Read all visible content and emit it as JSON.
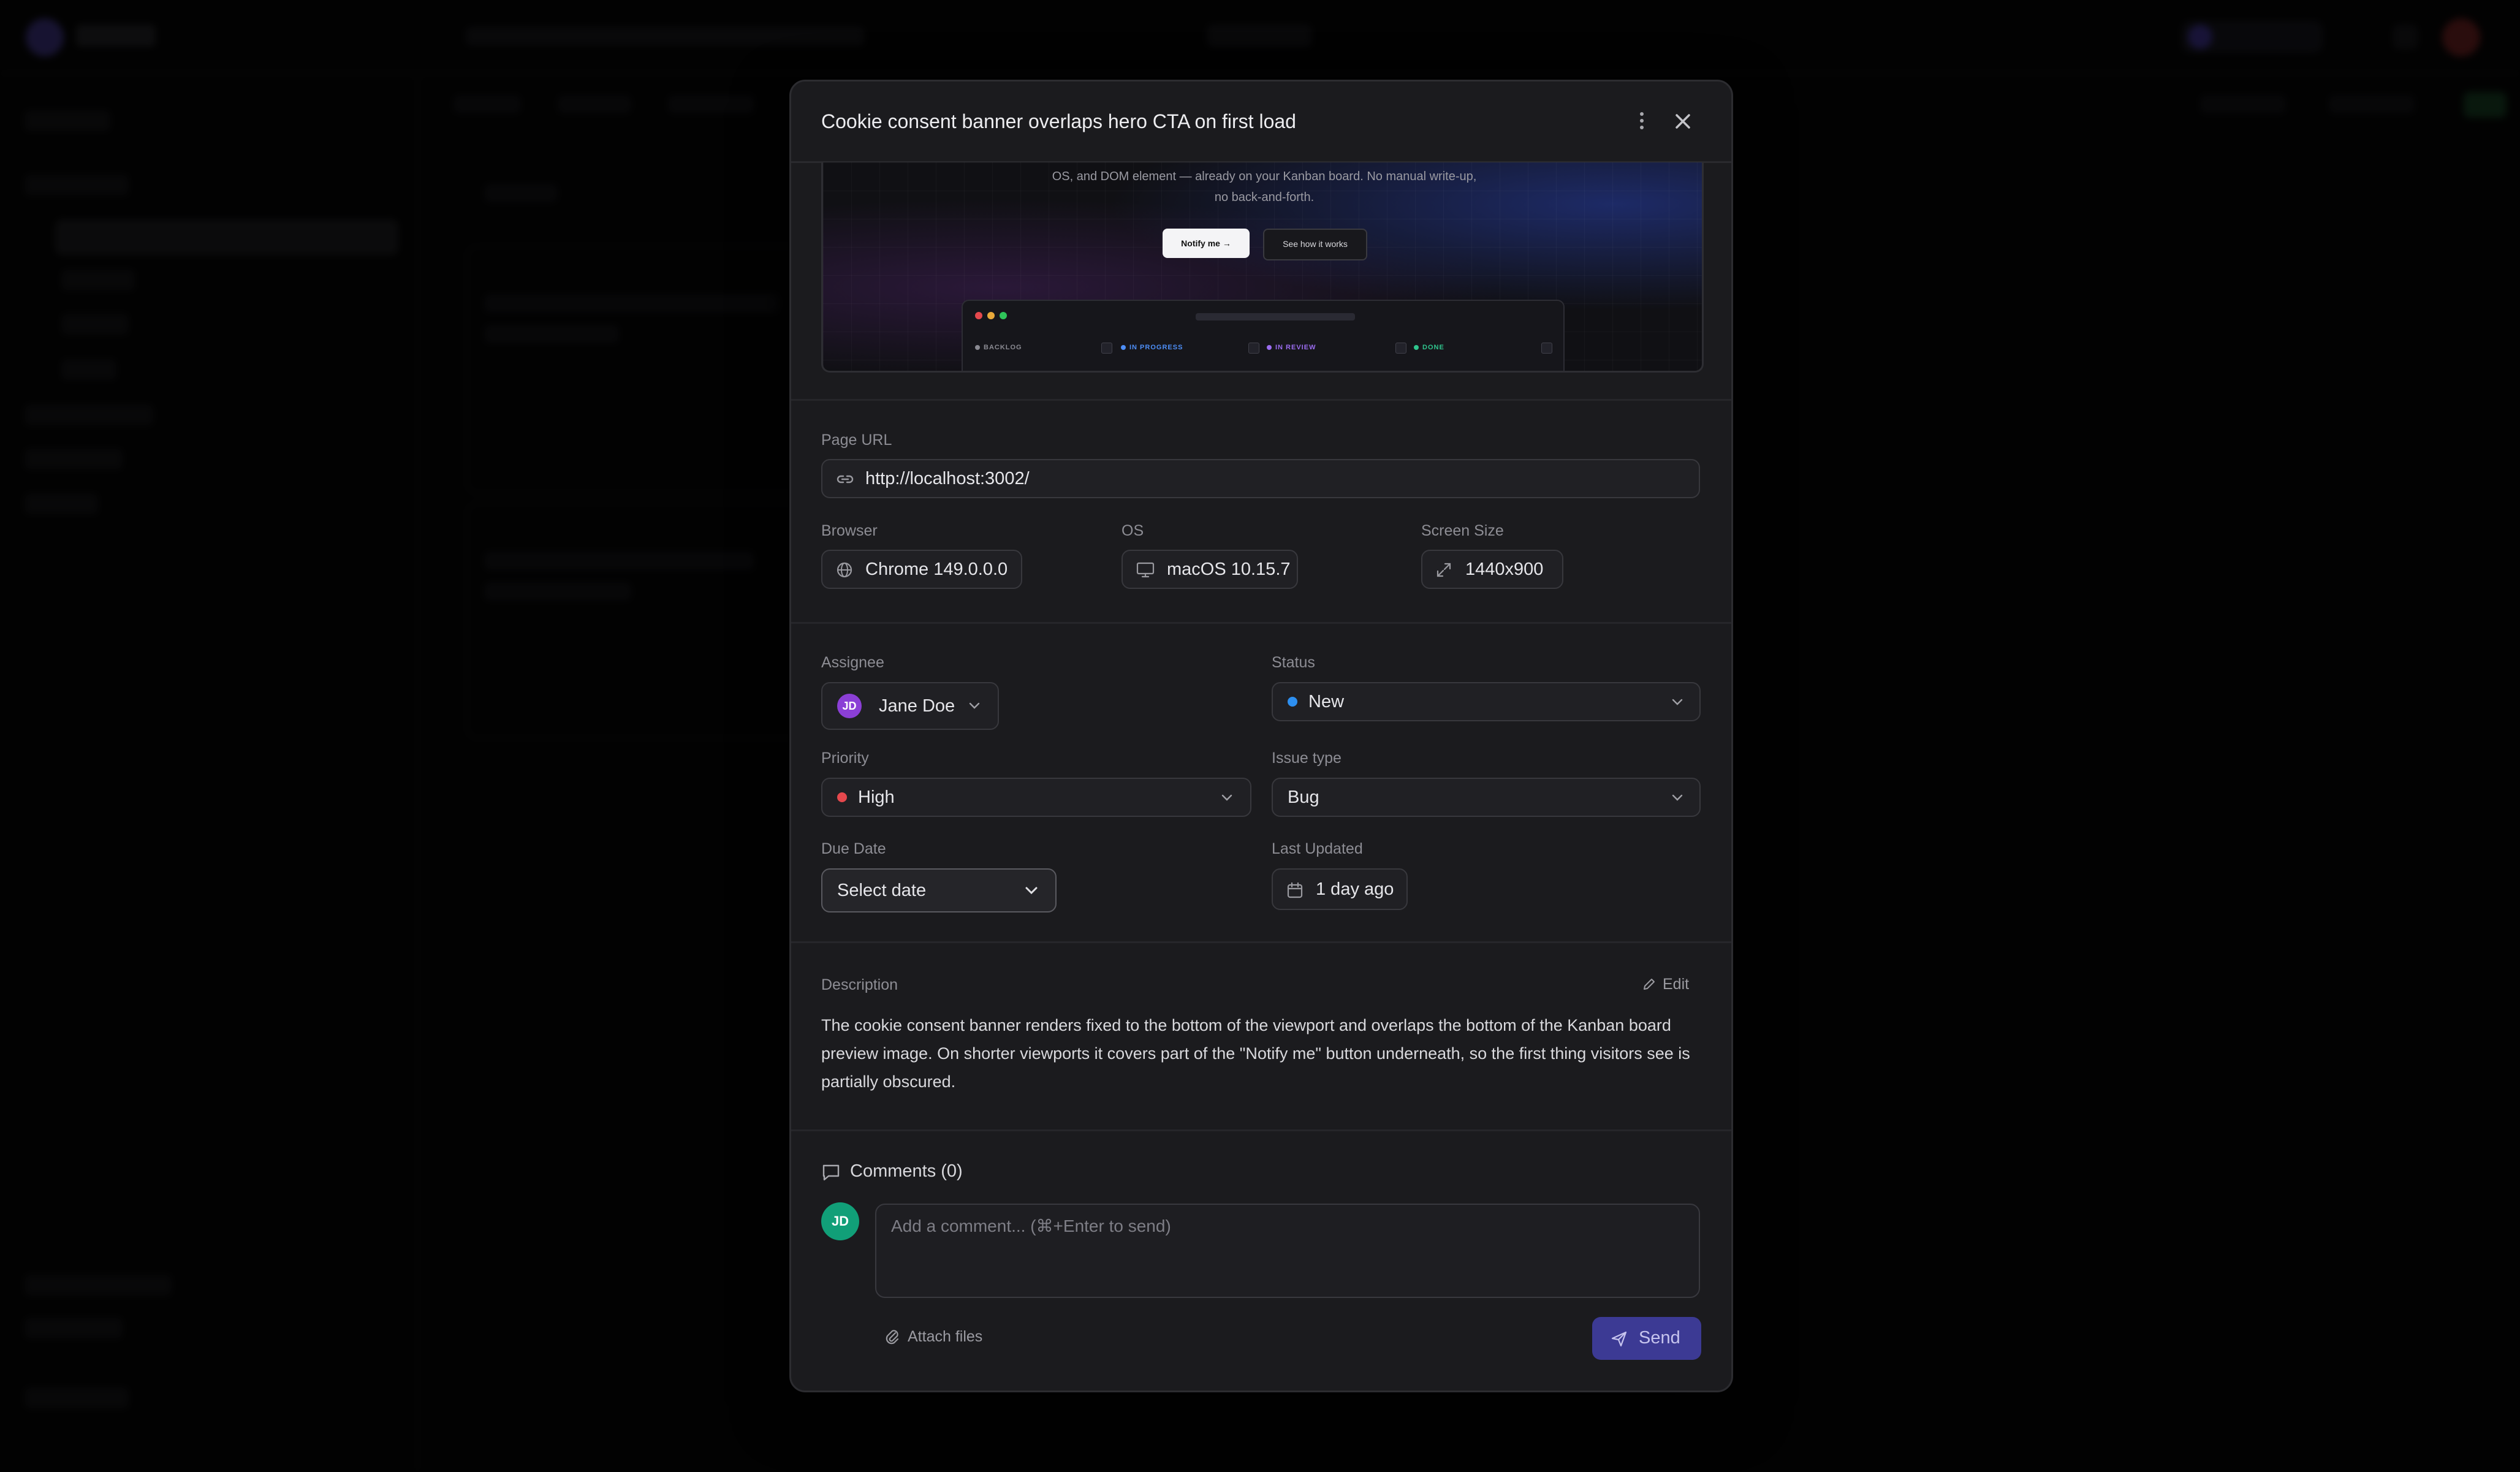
{
  "modal": {
    "title": "Cookie consent banner overlaps hero CTA on first load"
  },
  "screenshot_preview": {
    "text": "OS, and DOM element — already on your Kanban board. No manual write-up, no back-and-forth.",
    "notify_label": "Notify me →",
    "how_label": "See how it works",
    "columns": [
      {
        "label": "BACKLOG",
        "color": "#8a8a92"
      },
      {
        "label": "IN PROGRESS",
        "color": "#4d8ef7"
      },
      {
        "label": "IN REVIEW",
        "color": "#9b6cf0"
      },
      {
        "label": "DONE",
        "color": "#2fc48d"
      }
    ]
  },
  "page_url": {
    "label": "Page URL",
    "value": "http://localhost:3002/"
  },
  "environment": {
    "browser_label": "Browser",
    "browser_value": "Chrome 149.0.0.0",
    "os_label": "OS",
    "os_value": "macOS 10.15.7",
    "screen_label": "Screen Size",
    "screen_value": "1440x900"
  },
  "fields": {
    "assignee_label": "Assignee",
    "assignee_initials": "JD",
    "assignee_name": "Jane Doe",
    "status_label": "Status",
    "status_value": "New",
    "status_color": "#2d8ff0",
    "priority_label": "Priority",
    "priority_value": "High",
    "priority_color": "#e5484d",
    "issue_type_label": "Issue type",
    "issue_type_value": "Bug",
    "due_date_label": "Due Date",
    "due_date_value": "Select date",
    "last_updated_label": "Last Updated",
    "last_updated_value": "1 day ago"
  },
  "description": {
    "label": "Description",
    "edit_label": "Edit",
    "text": "The cookie consent banner renders fixed to the bottom of the viewport and overlaps the bottom of the Kanban board preview image. On shorter viewports it covers part of the \"Notify me\" button underneath, so the first thing visitors see is partially obscured."
  },
  "comments": {
    "title": "Comments (0)",
    "avatar_initials": "JD",
    "placeholder": "Add a comment... (⌘+Enter to send)",
    "attach_label": "Attach files",
    "send_label": "Send"
  }
}
